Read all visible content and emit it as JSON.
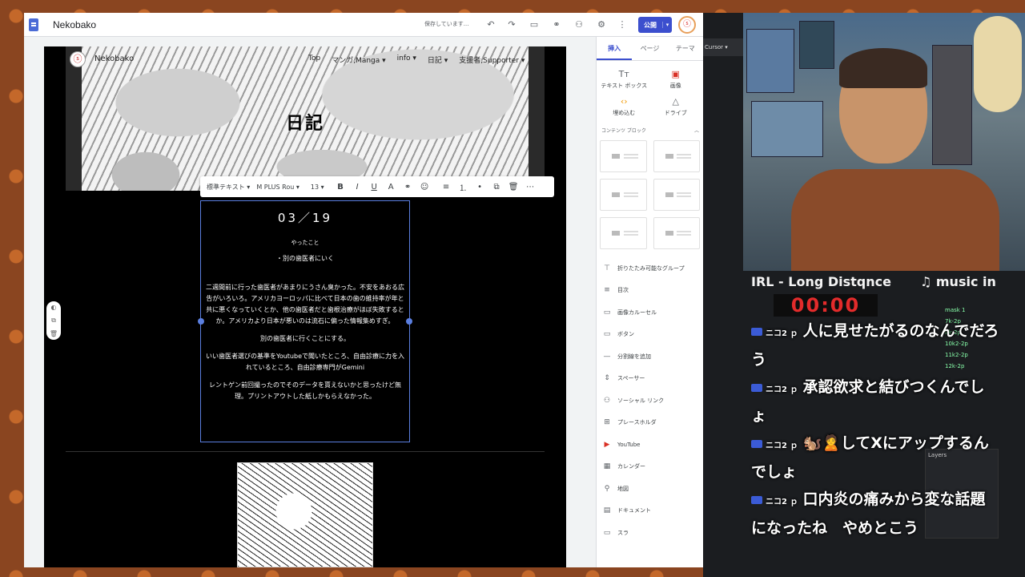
{
  "app": {
    "site_title": "Nekobako",
    "saving_status": "保存しています...",
    "publish_label": "公開",
    "avatar_glyph": "ⓢ"
  },
  "site": {
    "nav_name": "Nekobako",
    "nav_links": [
      "Top",
      "マンガ,Manga ▾",
      "info ▾",
      "日記 ▾",
      "支援者,Supporter ▾"
    ],
    "hero_title": "日記"
  },
  "format_bar": {
    "style_select": "標準テキスト ▾",
    "font_select": "M PLUS Rou ▾",
    "size_select": "13 ▾"
  },
  "post": {
    "date": "03／19",
    "lines": [
      "やったこと",
      "・別の歯医者にいく",
      "",
      "二週間前に行った歯医者があまりにうさん臭かった。不安をあおる広告がいろいろ。アメリカヨーロッパに比べて日本の歯の維持率が年と共に悪くなっていくとか、他の歯医者だと歯根治療がほぼ失敗するとか。アメリカより日本が悪いのは流石に偏った情報集めすぎ。",
      "別の歯医者に行くことにする。",
      "いい歯医者選びの基準をYoutubeで聞いたところ、自由診療に力を入れているところ、自由診療専門がGemini",
      "レントゲン前回撮ったのでそのデータを貰えないかと思ったけど無理。プリントアウトした紙しかもらえなかった。"
    ]
  },
  "panel": {
    "tabs": [
      "挿入",
      "ページ",
      "テーマ"
    ],
    "quick": [
      {
        "label": "テキスト ボックス",
        "icon": "Tт"
      },
      {
        "label": "画像",
        "icon": "▣"
      },
      {
        "label": "埋め込む",
        "icon": "‹›"
      },
      {
        "label": "ドライブ",
        "icon": "△"
      }
    ],
    "blocks_title": "コンテンツ ブロック",
    "items": [
      {
        "label": "折りたたみ可能なグループ",
        "icon": "⊤"
      },
      {
        "label": "目次",
        "icon": "≡"
      },
      {
        "label": "画像カルーセル",
        "icon": "▭"
      },
      {
        "label": "ボタン",
        "icon": "▭"
      },
      {
        "label": "分割線を追加",
        "icon": "—"
      },
      {
        "label": "スペーサー",
        "icon": "⇕"
      },
      {
        "label": "ソーシャル リンク",
        "icon": "⚇"
      },
      {
        "label": "プレースホルダ",
        "icon": "⊞"
      },
      {
        "label": "YouTube",
        "icon": "▶"
      },
      {
        "label": "カレンダー",
        "icon": "▦"
      },
      {
        "label": "地図",
        "icon": "⚲"
      },
      {
        "label": "ドキュメント",
        "icon": "▤"
      },
      {
        "label": "スラ",
        "icon": "▭"
      }
    ]
  },
  "overlay": {
    "app_strip": "Cursor ▾",
    "now_playing": "IRL - Long Distqnce",
    "music_label": "♫ music in",
    "timer": "00:00",
    "messages": [
      {
        "user": "ニコ2 ｐ",
        "text": "人に見せたがるのなんでだろう"
      },
      {
        "user": "ニコ2 ｐ",
        "text": "承認欲求と結びつくんでしょ"
      },
      {
        "user": "ニコ2 ｐ",
        "text": "🐿️🙎してXにアップするんでしょ"
      },
      {
        "user": "ニコ2 ｐ",
        "text": "口内炎の痛みから変な話題になったね　やめとこう"
      }
    ],
    "daw_tracks": [
      "mask 1",
      "7k-2p",
      "8k-2p",
      "10k2-2p",
      "11k2-2p",
      "12k-2p"
    ],
    "layers_label": "Layers"
  }
}
